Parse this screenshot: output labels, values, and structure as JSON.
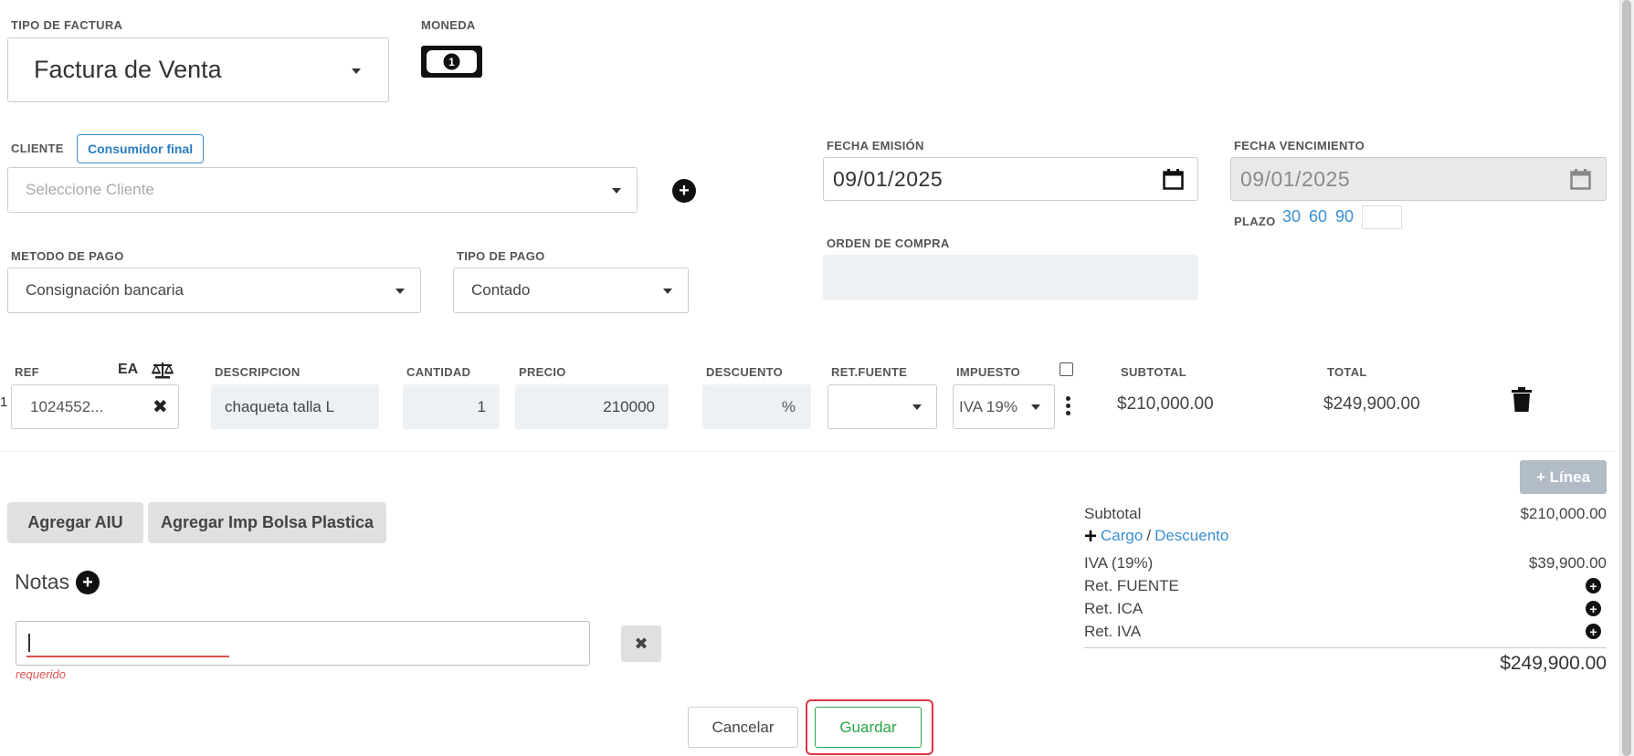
{
  "invoice_type": {
    "label": "TIPO DE FACTURA",
    "value": "Factura de Venta"
  },
  "currency": {
    "label": "MONEDA",
    "icon": "money-bill-icon"
  },
  "client": {
    "label": "CLIENTE",
    "badge": "Consumidor final",
    "placeholder": "Seleccione Cliente"
  },
  "issue_date": {
    "label": "FECHA EMISIÓN",
    "value": "09/01/2025"
  },
  "due_date": {
    "label": "FECHA VENCIMIENTO",
    "value": "09/01/2025"
  },
  "term": {
    "label": "PLAZO",
    "options": [
      "30",
      "60",
      "90"
    ],
    "value": ""
  },
  "payment_method": {
    "label": "METODO DE PAGO",
    "value": "Consignación bancaria"
  },
  "payment_type": {
    "label": "TIPO DE PAGO",
    "value": "Contado"
  },
  "purchase_order": {
    "label": "ORDEN DE COMPRA",
    "value": ""
  },
  "columns": {
    "ref": "REF",
    "unit": "EA",
    "description": "DESCRIPCION",
    "quantity": "CANTIDAD",
    "price": "PRECIO",
    "discount": "DESCUENTO",
    "retention": "RET.FUENTE",
    "tax": "IMPUESTO",
    "subtotal": "SUBTOTAL",
    "total": "TOTAL"
  },
  "line": {
    "number": "1",
    "ref": "1024552...",
    "description": "chaqueta talla L",
    "quantity": "1",
    "price": "210000",
    "discount_suffix": "%",
    "tax": "IVA 19%",
    "subtotal": "$210,000.00",
    "total": "$249,900.00"
  },
  "add_line_label": "+ Línea",
  "buttons": {
    "aiu": "Agregar AIU",
    "bolsa": "Agregar Imp Bolsa Plastica",
    "cancel": "Cancelar",
    "save": "Guardar"
  },
  "notes": {
    "title": "Notas",
    "value": "",
    "error": "requerido"
  },
  "summary": {
    "subtotal_label": "Subtotal",
    "subtotal_value": "$210,000.00",
    "charge": "Cargo",
    "separator": "/",
    "discount": "Descuento",
    "iva_label": "IVA (19%)",
    "iva_value": "$39,900.00",
    "ret_fuente": "Ret. FUENTE",
    "ret_ica": "Ret. ICA",
    "ret_iva": "Ret. IVA",
    "total": "$249,900.00"
  },
  "colors": {
    "accent": "#3a8fd0",
    "success": "#28a745",
    "danger": "#dc3545"
  }
}
